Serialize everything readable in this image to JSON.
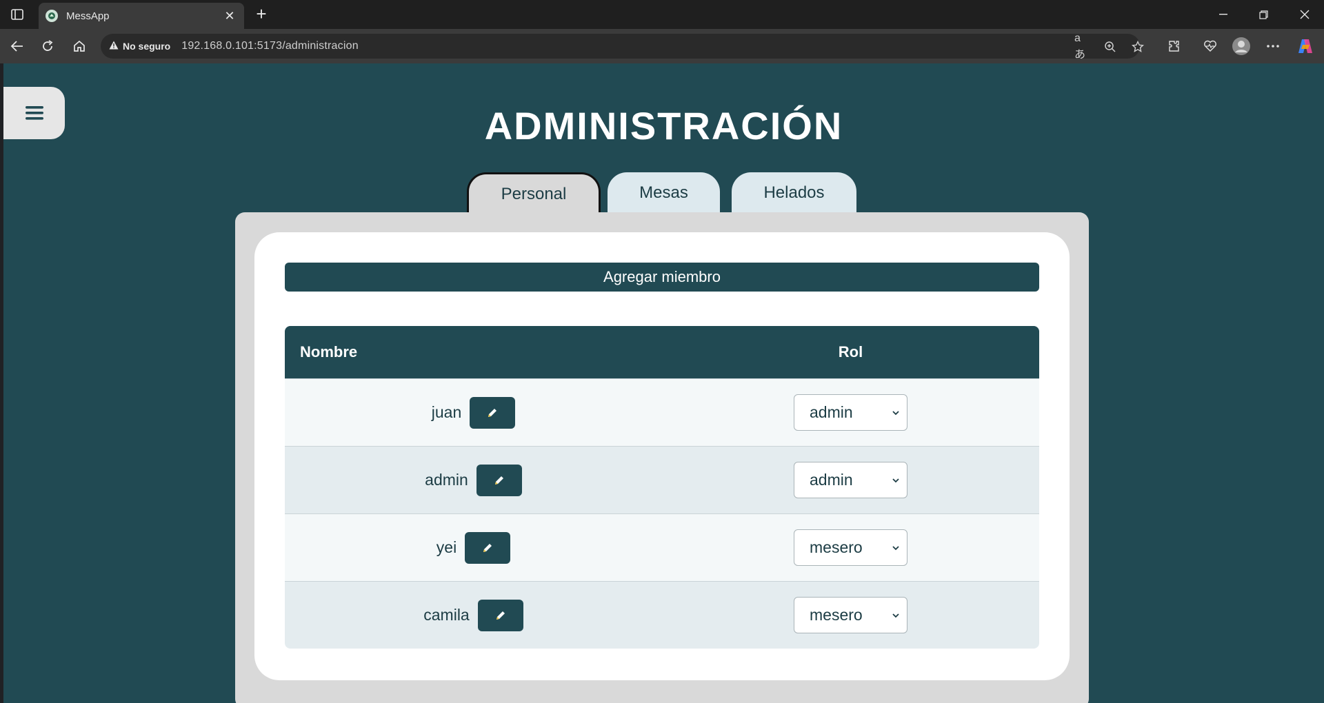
{
  "browser": {
    "tab_title": "MessApp",
    "new_tab_symbol": "+",
    "security_label": "No seguro",
    "url": "192.168.0.101:5173/administracion"
  },
  "page": {
    "title": "ADMINISTRACIÓN",
    "tabs": [
      {
        "label": "Personal",
        "active": true
      },
      {
        "label": "Mesas",
        "active": false
      },
      {
        "label": "Helados",
        "active": false
      }
    ],
    "add_button_label": "Agregar miembro",
    "table": {
      "headers": {
        "name": "Nombre",
        "role": "Rol"
      },
      "rows": [
        {
          "name": "juan",
          "role": "admin"
        },
        {
          "name": "admin",
          "role": "admin"
        },
        {
          "name": "yei",
          "role": "mesero"
        },
        {
          "name": "camila",
          "role": "mesero"
        }
      ]
    }
  },
  "colors": {
    "page_bg": "#214a53",
    "panel_bg": "#d9d9d9",
    "tab_bg": "#dde9ee",
    "text_dark": "#1c3c44"
  }
}
